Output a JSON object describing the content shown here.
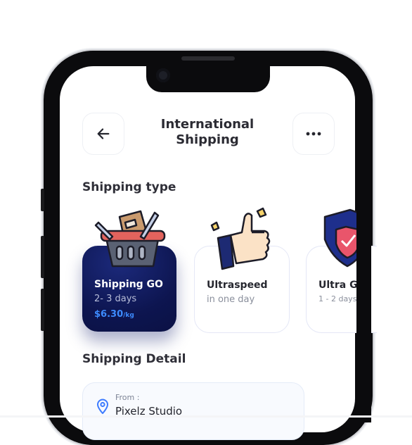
{
  "header": {
    "title_line1": "International",
    "title_line2": "Shipping",
    "back_icon": "arrow-left-icon",
    "more_icon": "more-horizontal-icon"
  },
  "shipping_type": {
    "heading": "Shipping type",
    "options": [
      {
        "name": "Shipping GO",
        "days": "2- 3 days",
        "price": "$6.30",
        "unit": "/kg",
        "selected": true,
        "icon": "shopping-basket-icon"
      },
      {
        "name": "Ultraspeed",
        "days": "in one day",
        "selected": false,
        "icon": "thumbs-up-icon"
      },
      {
        "name": "Ultra Gu",
        "days": "1 - 2 days",
        "selected": false,
        "icon": "shield-check-icon"
      }
    ]
  },
  "shipping_detail": {
    "heading": "Shipping Detail",
    "from_label": "From :",
    "from_value": "Pixelz Studio",
    "from_icon": "location-pin-icon"
  },
  "colors": {
    "accent_dark": "#0d1550",
    "price_blue": "#3d8bff",
    "text_dark": "#2b2b33",
    "text_muted": "#8a8f9c"
  }
}
